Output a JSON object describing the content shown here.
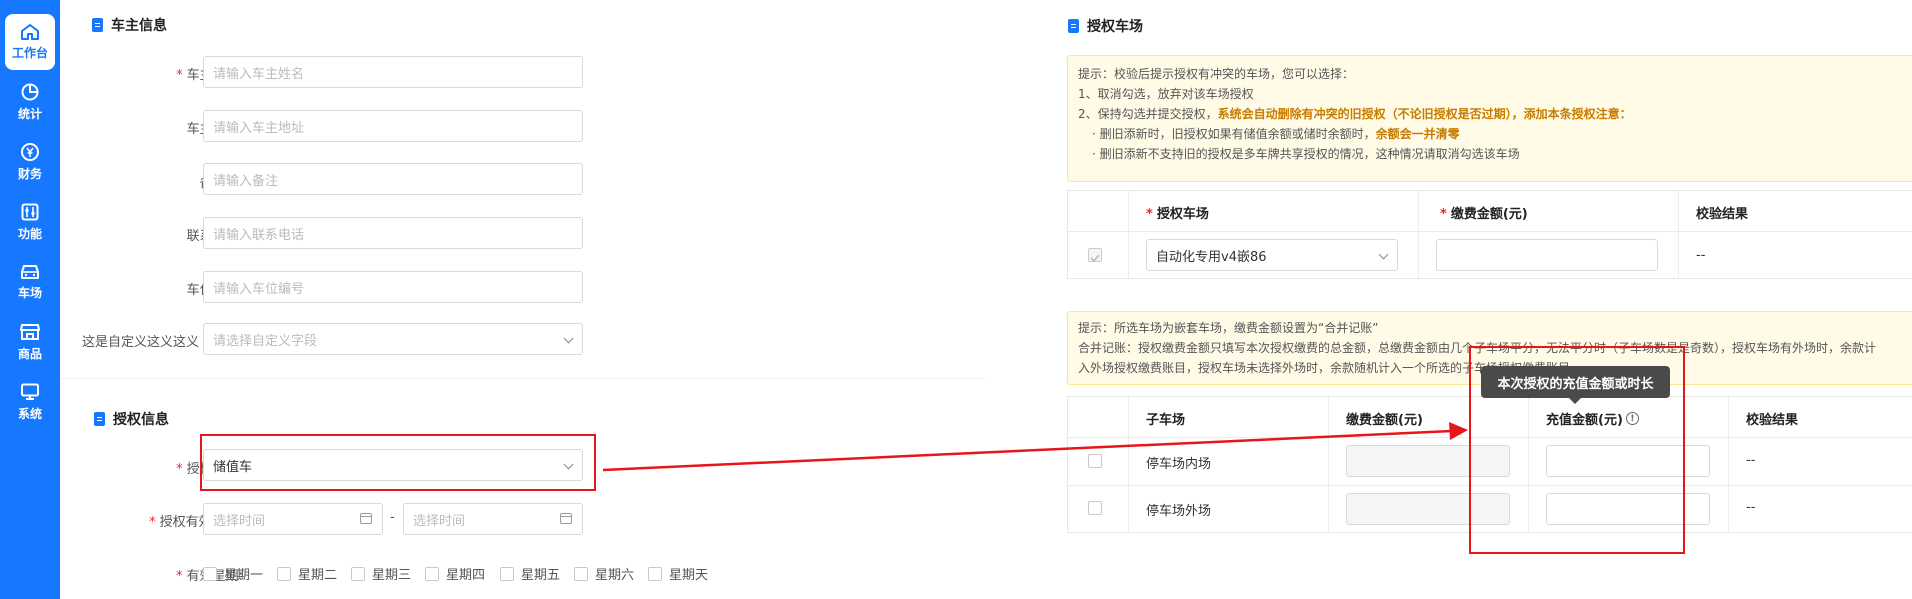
{
  "sidebar": {
    "items": [
      {
        "label": "工作台",
        "icon": "home-icon"
      },
      {
        "label": "统计",
        "icon": "pie-chart-icon"
      },
      {
        "label": "财务",
        "icon": "yen-icon"
      },
      {
        "label": "功能",
        "icon": "sliders-icon"
      },
      {
        "label": "车场",
        "icon": "car-icon"
      },
      {
        "label": "商品",
        "icon": "shop-icon"
      },
      {
        "label": "系统",
        "icon": "monitor-icon"
      }
    ]
  },
  "owner_section": {
    "title": "车主信息",
    "fields": [
      {
        "label": "车主姓名:",
        "required": "*",
        "placeholder": "请输入车主姓名"
      },
      {
        "label": "车主地址:",
        "placeholder": "请输入车主地址"
      },
      {
        "label": "备注一:",
        "placeholder": "请输入备注"
      },
      {
        "label": "联系电话:",
        "placeholder": "请输入联系电话"
      },
      {
        "label": "车位编号:",
        "placeholder": "请输入车位编号"
      },
      {
        "label": "这是自定义这义这义",
        "placeholder": "请选择自定义字段"
      }
    ]
  },
  "auth_section": {
    "title": "授权信息",
    "type_label": "授权类型:",
    "type_value": "储值车",
    "validity_label": "授权有效期:",
    "start_placeholder": "选择时间",
    "range_sep": "-",
    "end_placeholder": "选择时间",
    "weekday_label": "有效星期:",
    "weekdays": [
      "星期一",
      "星期二",
      "星期三",
      "星期四",
      "星期五",
      "星期六",
      "星期天"
    ],
    "required": "*"
  },
  "parking_section": {
    "title": "授权车场",
    "tip1": {
      "line1": "提示：校验后提示授权有冲突的车场，您可以选择：",
      "line2": "1、取消勾选，放弃对该车场授权",
      "line3_a": "2、保持勾选并提交授权，",
      "line3_b": "系统会自动删除有冲突的旧授权（不论旧授权是否过期），添加本条授权注意：",
      "line4_a": "· 删旧添新时，旧授权如果有储值余额或储时余额时，",
      "line4_b": "余额会一并清零",
      "line5": "· 删旧添新不支持旧的授权是多车牌共享授权的情况，这种情况请取消勾选该车场"
    },
    "table1": {
      "headers": [
        "授权车场",
        "缴费金额(元)",
        "校验结果"
      ],
      "row": {
        "lot": "自动化专用v4嵌86",
        "result": "--"
      }
    },
    "tip2": {
      "line1": "提示：所选车场为嵌套车场，缴费金额设置为“合并记账”",
      "line2": "合并记账：授权缴费金额只填写本次授权缴费的总金额，总缴费金额由几个子车场平分，无法平分时（子车场数是是奇数），授权车场有外场时，余款计",
      "line3": "入外场授权缴费账目，授权车场未选择外场时，余款随机计入一个所选的子车场授权缴费账目"
    },
    "table2": {
      "headers": [
        "子车场",
        "缴费金额(元)",
        "充值金额(元)",
        "校验结果"
      ],
      "rows": [
        {
          "name": "停车场内场",
          "result": "--"
        },
        {
          "name": "停车场外场",
          "result": "--"
        }
      ]
    },
    "tooltip": "本次授权的充值金额或时长",
    "info_glyph": "!"
  },
  "colors": {
    "primary": "#1677ff",
    "annotation": "#e8161b"
  }
}
